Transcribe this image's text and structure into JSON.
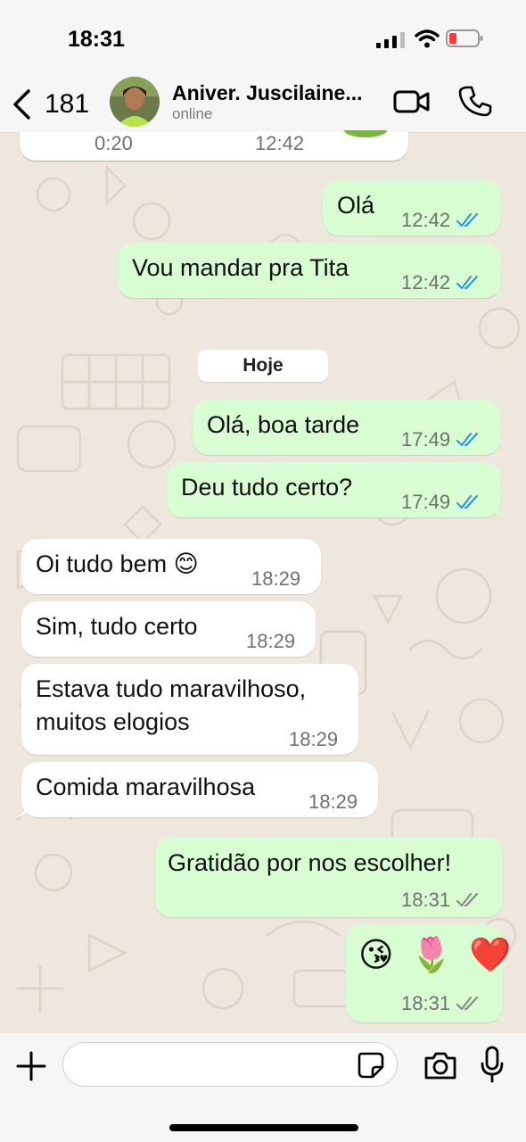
{
  "status_bar": {
    "time": "18:31"
  },
  "header": {
    "back_count": "181",
    "contact_name": "Aniver. Juscilaine...",
    "contact_status": "online"
  },
  "messages": [
    {
      "direction": "in",
      "audio_duration": "0:20",
      "time": "12:42"
    },
    {
      "direction": "out",
      "text": "Olá",
      "time": "12:42",
      "status": "read"
    },
    {
      "direction": "out",
      "text": "Vou mandar pra Tita",
      "time": "12:42",
      "status": "read"
    },
    {
      "direction": "out",
      "text": "Olá, boa tarde",
      "time": "17:49",
      "status": "read"
    },
    {
      "direction": "out",
      "text": "Deu tudo certo?",
      "time": "17:49",
      "status": "read"
    },
    {
      "direction": "in",
      "text": "Oi tudo bem 😊",
      "time": "18:29"
    },
    {
      "direction": "in",
      "text": "Sim, tudo certo",
      "time": "18:29"
    },
    {
      "direction": "in",
      "text_line1": "Estava tudo maravilhoso,",
      "text_line2": "muitos elogios",
      "time": "18:29"
    },
    {
      "direction": "in",
      "text": "Comida maravilhosa",
      "time": "18:29"
    },
    {
      "direction": "out",
      "text": "Gratidão por nos escolher!",
      "time": "18:31",
      "status": "delivered"
    },
    {
      "direction": "out",
      "emojis": [
        "😘",
        "🌷",
        "❤️"
      ],
      "time": "18:31",
      "status": "delivered"
    }
  ],
  "date_separator": "Hoje",
  "input": {
    "placeholder": ""
  },
  "colors": {
    "outgoing_bubble": "#d9fdd3",
    "incoming_bubble": "#ffffff",
    "read_ticks": "#2f9bd6",
    "delivered_ticks": "#8a8a8a",
    "wallpaper": "#eee7dd"
  },
  "icons": [
    "back-chevron-icon",
    "video-call-icon",
    "phone-icon",
    "plus-icon",
    "sticker-icon",
    "camera-icon",
    "microphone-icon",
    "signal-icon",
    "wifi-icon",
    "battery-icon"
  ]
}
